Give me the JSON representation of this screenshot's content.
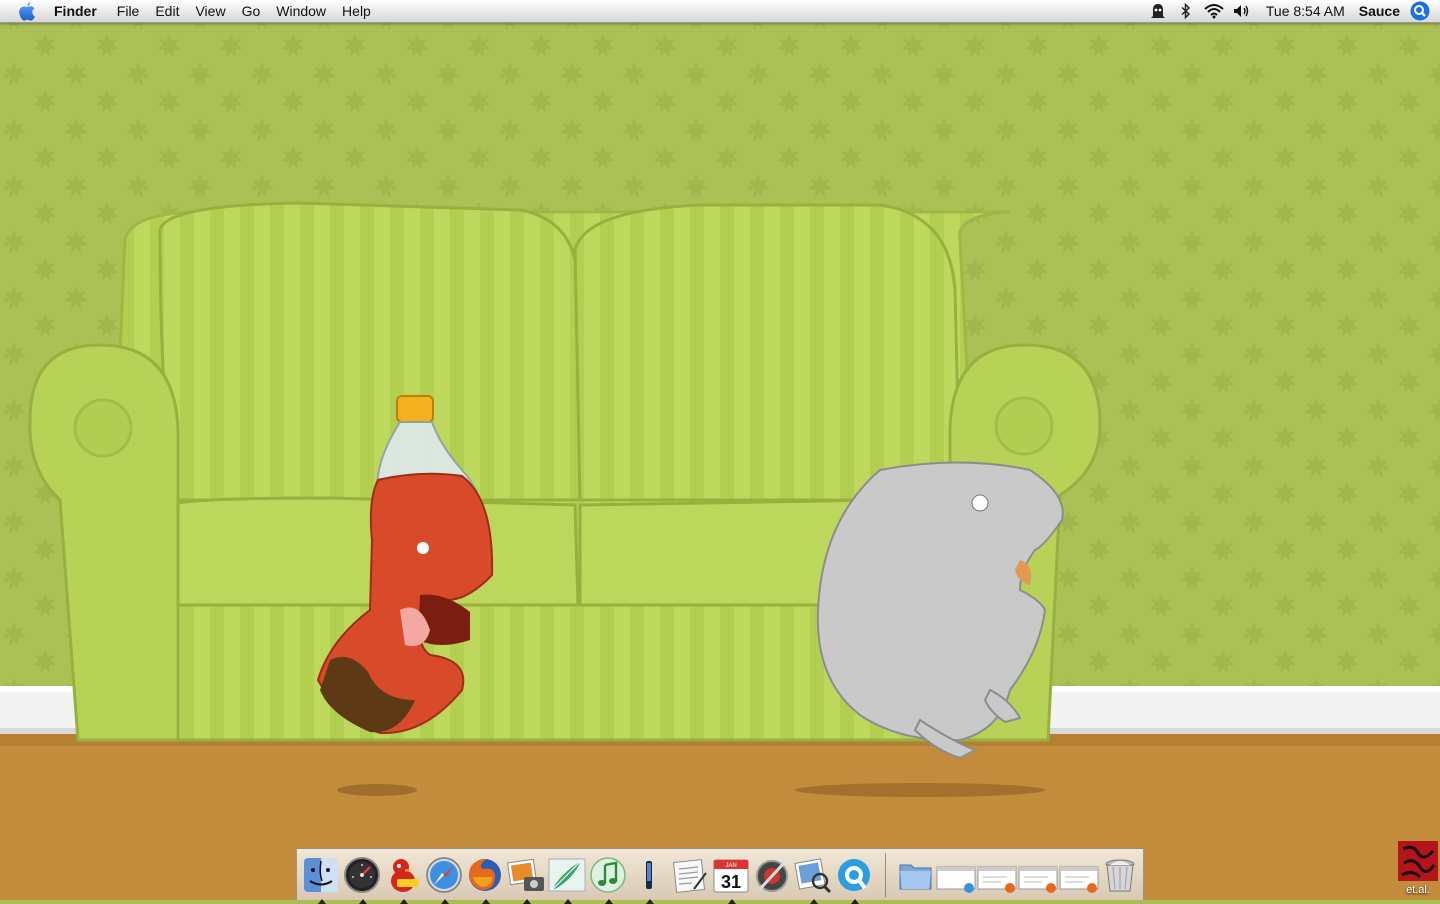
{
  "menubar": {
    "apple_icon": "apple-icon",
    "app_name": "Finder",
    "menus": [
      "File",
      "Edit",
      "View",
      "Go",
      "Window",
      "Help"
    ],
    "status_icons": [
      "cloak-icon",
      "bluetooth-icon",
      "wifi-icon",
      "volume-icon"
    ],
    "clock": "Tue 8:54 AM",
    "user": "Sauce",
    "spotlight_icon": "spotlight-search-icon"
  },
  "wallpaper": {
    "colors": {
      "wall": "#a9bf55",
      "couch": "#b9d45a",
      "floor": "#c28c3c",
      "baseboard": "#f4f4f4",
      "bottle": "#d94a2a",
      "monster": "#c9c9c9"
    }
  },
  "dock": {
    "apps": [
      {
        "name": "Finder",
        "icon": "finder-icon",
        "running": true
      },
      {
        "name": "Dashboard",
        "icon": "dashboard-icon",
        "running": true
      },
      {
        "name": "Adium",
        "icon": "adium-duck-icon",
        "running": true
      },
      {
        "name": "Safari",
        "icon": "safari-compass-icon",
        "running": true
      },
      {
        "name": "Firefox",
        "icon": "firefox-icon",
        "running": true
      },
      {
        "name": "iPhoto",
        "icon": "iphoto-icon",
        "running": true
      },
      {
        "name": "Mail",
        "icon": "mail-quill-icon",
        "running": true
      },
      {
        "name": "iTunes",
        "icon": "itunes-icon",
        "running": true
      },
      {
        "name": "Terminal",
        "icon": "terminal-icon",
        "running": true
      },
      {
        "name": "TextEdit",
        "icon": "textedit-icon",
        "running": false
      },
      {
        "name": "iCal",
        "icon": "ical-icon",
        "running": true,
        "date_day": "31",
        "date_month": "JAN"
      },
      {
        "name": "Coda",
        "icon": "disk-utility-icon",
        "running": false
      },
      {
        "name": "Preview",
        "icon": "preview-icon",
        "running": true
      },
      {
        "name": "QuickTime",
        "icon": "quicktime-icon",
        "running": true
      }
    ],
    "docs": [
      {
        "name": "Applications",
        "icon": "folder-icon"
      },
      {
        "name": "Window 1",
        "icon": "minimized-window-icon"
      },
      {
        "name": "Window 2",
        "icon": "minimized-window-icon"
      },
      {
        "name": "Window 3",
        "icon": "minimized-window-icon"
      },
      {
        "name": "Window 4",
        "icon": "minimized-window-icon"
      },
      {
        "name": "Trash",
        "icon": "trash-icon"
      }
    ]
  },
  "desktop_item": {
    "label": "et.al."
  }
}
